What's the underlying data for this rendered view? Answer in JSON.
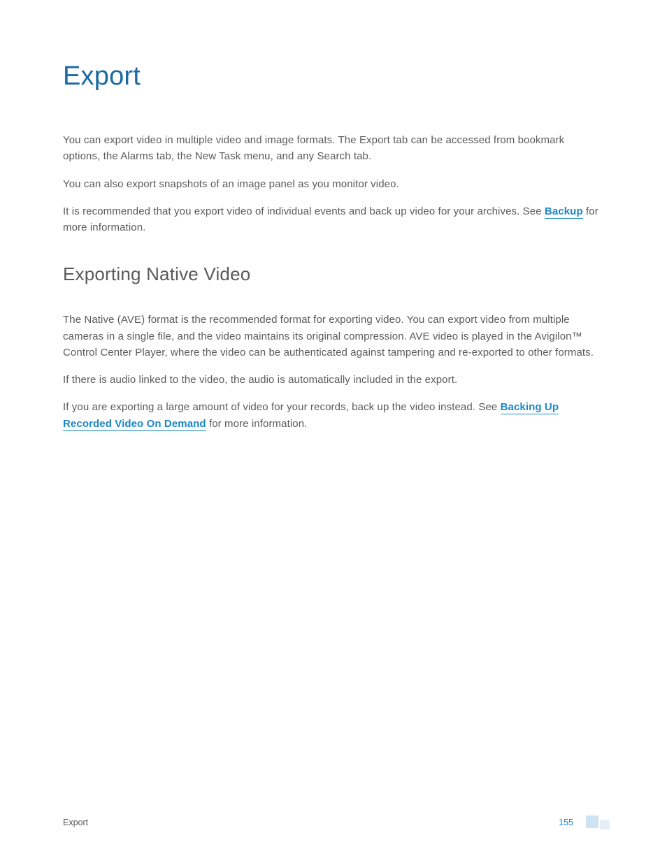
{
  "title": "Export",
  "intro_p1": "You can export video in multiple video and image formats. The Export tab can be accessed from bookmark options, the Alarms tab, the New Task menu, and any Search tab.",
  "intro_p2": "You can also export snapshots of an image panel as you monitor video.",
  "intro_p3_part1": " It is recommended that you export video of individual events and back up video for your archives. See ",
  "intro_p3_link": "Backup",
  "intro_p3_part2": " for more information.",
  "section1": {
    "title": "Exporting Native Video",
    "p1": "The Native (AVE) format is the recommended format for exporting video. You can export video from multiple cameras in a single file, and the video maintains its original compression. AVE video is played in the Avigilon™ Control Center Player, where the video can be authenticated against tampering and re-exported to other formats.",
    "p2": "If there is audio linked to the video, the audio is automatically included in the export.",
    "p3_part1": "If you are exporting a large amount of video for your records, back up the video instead. See ",
    "p3_link": "Backing Up Recorded Video On Demand",
    "p3_part2": " for more information."
  },
  "footer": {
    "section_label": "Export",
    "page_number": "155"
  }
}
